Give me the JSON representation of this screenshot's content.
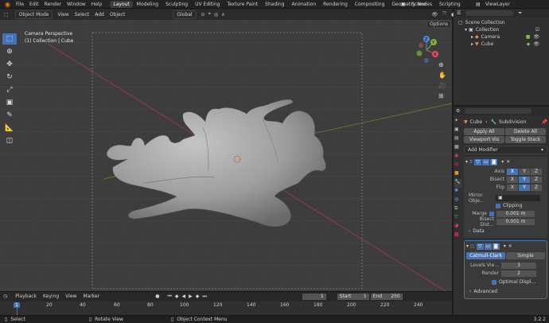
{
  "topbar": {
    "menus": [
      "File",
      "Edit",
      "Render",
      "Window",
      "Help"
    ],
    "workspaces": [
      "Layout",
      "Modeling",
      "Sculpting",
      "UV Editing",
      "Texture Paint",
      "Shading",
      "Animation",
      "Rendering",
      "Compositing",
      "Geometry Nodes",
      "Scripting"
    ],
    "active_workspace": "Layout",
    "scene": "Scene",
    "view_layer": "ViewLayer"
  },
  "viewport_header": {
    "mode": "Object Mode",
    "menus": [
      "View",
      "Select",
      "Add",
      "Object"
    ],
    "transform_orientation": "Global",
    "options": "Options"
  },
  "viewport": {
    "camera_label": "Camera Perspective",
    "selection_label": "(1) Collection | Cube",
    "gizmo": {
      "x": "X",
      "y": "Y",
      "z": "Z"
    }
  },
  "outliner": {
    "root": "Scene Collection",
    "collection": "Collection",
    "items": [
      "Camera",
      "Cube"
    ]
  },
  "properties": {
    "object": "Cube",
    "modifier": "Subdivision",
    "buttons": {
      "apply_all": "Apply All",
      "delete_all": "Delete All",
      "viewport_vis": "Viewport Vis",
      "toggle_stack": "Toggle Stack"
    },
    "add_modifier": "Add Modifier",
    "mirror": {
      "axis_label": "Axis",
      "bisect_label": "Bisect",
      "flip_label": "Flip",
      "axes": [
        "X",
        "Y",
        "Z"
      ],
      "mirror_object_label": "Mirror Obje...",
      "clipping_label": "Clipping",
      "merge_label": "Merge",
      "merge_value": "0.001 m",
      "bisect_dist_label": "Bisect Dist...",
      "bisect_dist_value": "0.001 m",
      "data_label": "Data"
    },
    "subdivision": {
      "catmull": "Catmull-Clark",
      "simple": "Simple",
      "levels_label": "Levels Vie...",
      "levels_value": "3",
      "render_label": "Render",
      "render_value": "2",
      "optimal_label": "Optimal Displ...",
      "advanced_label": "Advanced"
    }
  },
  "timeline": {
    "menus": [
      "Playback",
      "Keying",
      "View",
      "Marker"
    ],
    "current_frame": "1",
    "start_label": "Start",
    "start_value": "1",
    "end_label": "End",
    "end_value": "250",
    "ticks": [
      "1",
      "20",
      "40",
      "60",
      "80",
      "100",
      "120",
      "140",
      "160",
      "180",
      "200",
      "220",
      "240"
    ]
  },
  "statusbar": {
    "select": "Select",
    "rotate": "Rotate View",
    "context": "Object Context Menu",
    "version": "3.2.2"
  },
  "colors": {
    "accent": "#4772b3",
    "x_axis": "#d6505e",
    "y_axis": "#7fb439",
    "z_axis": "#4f86d9"
  }
}
